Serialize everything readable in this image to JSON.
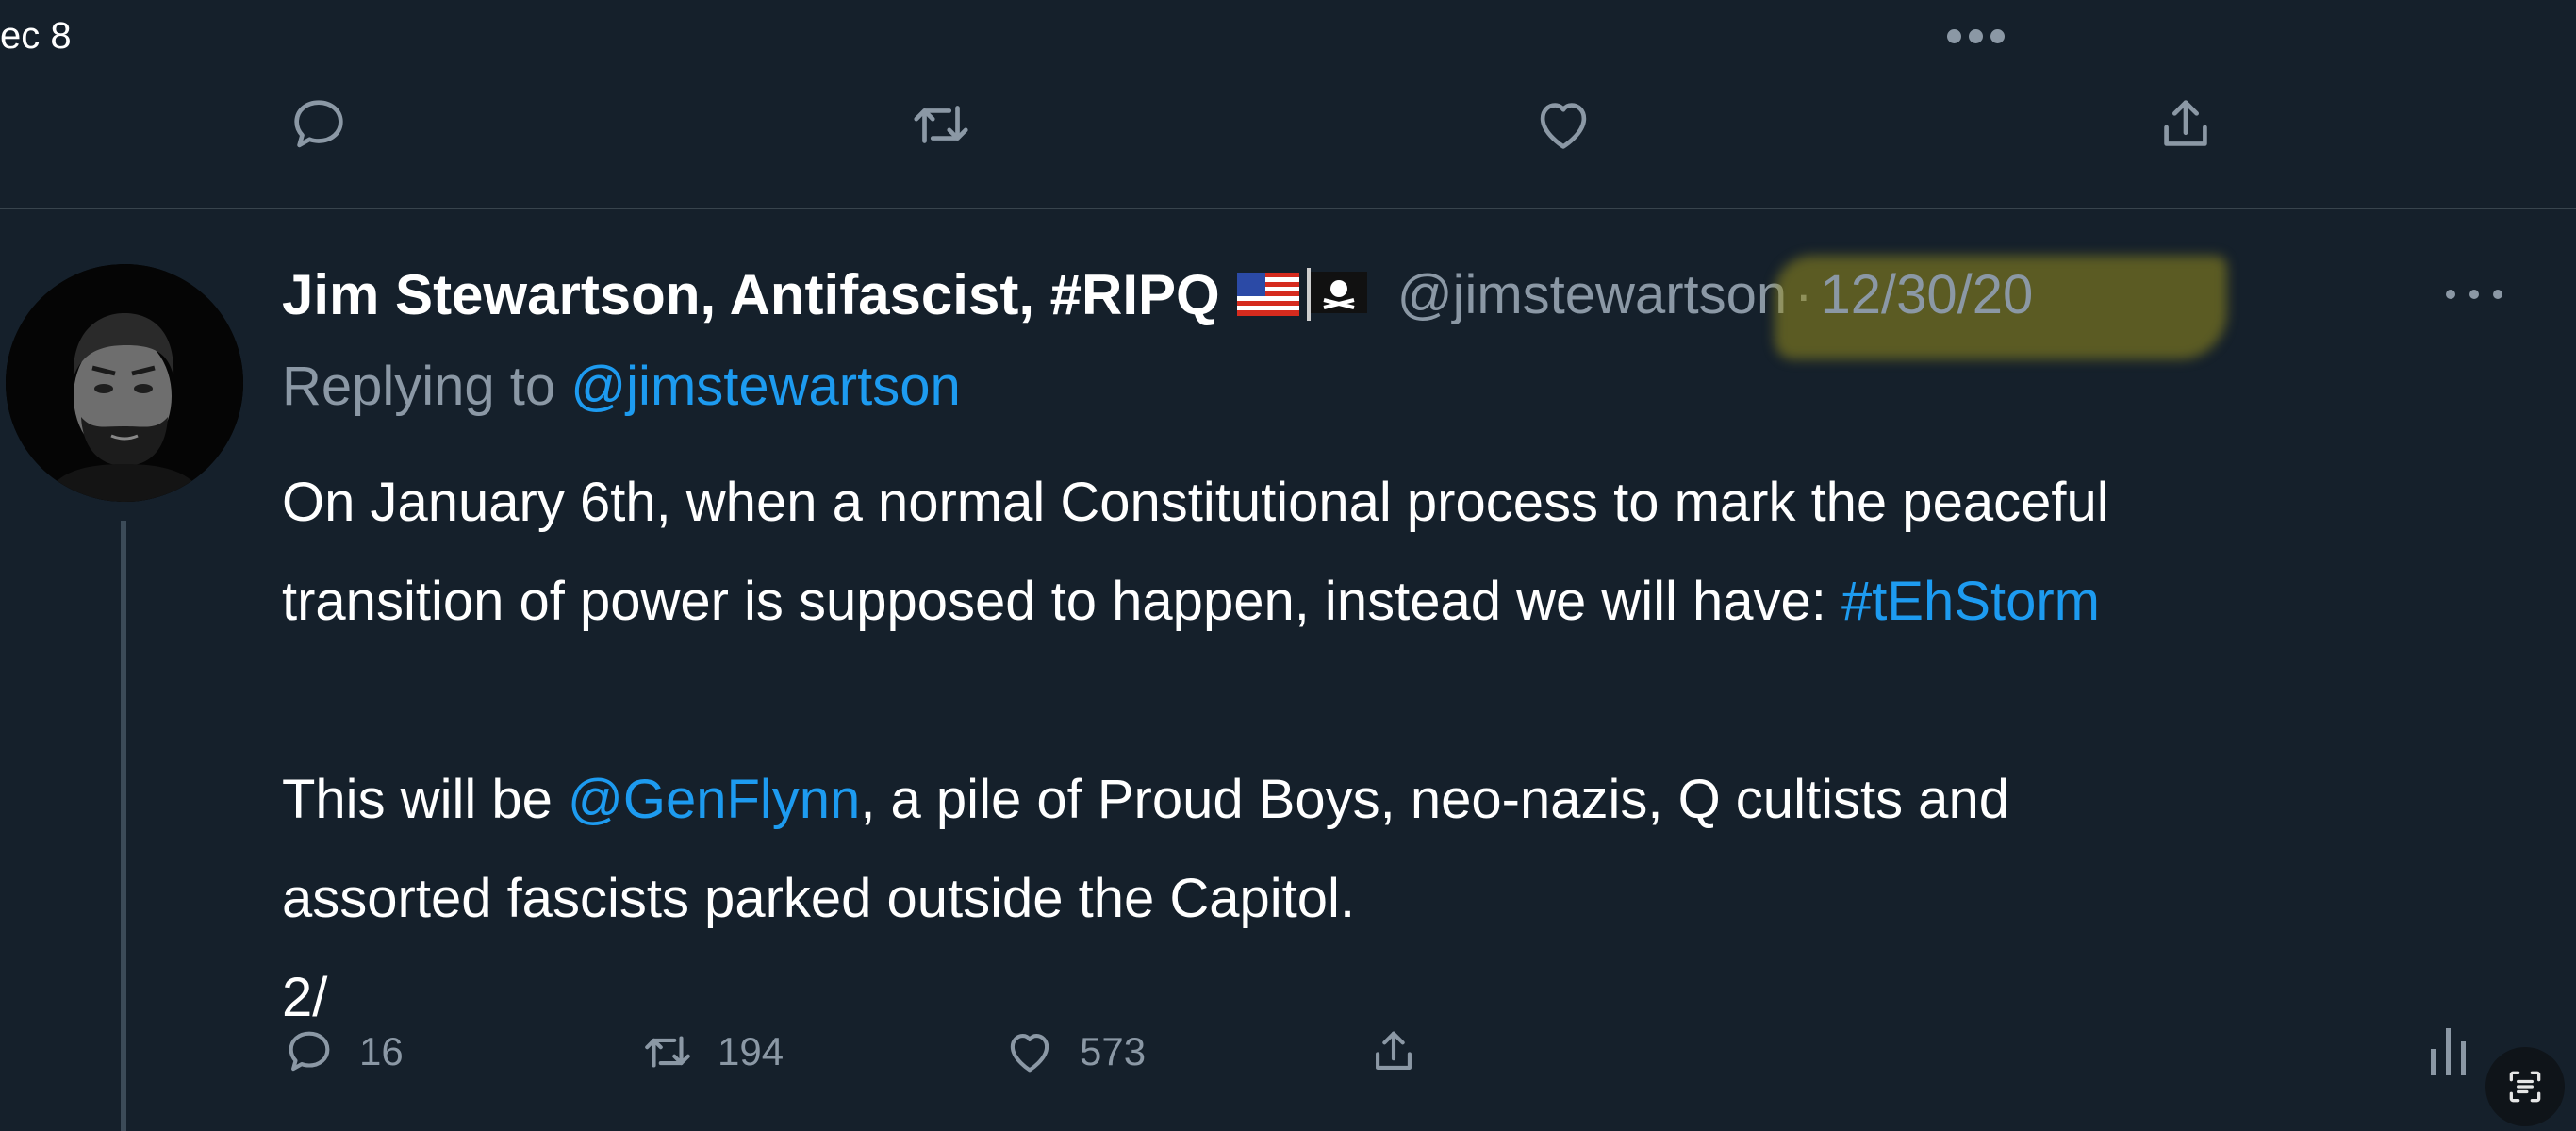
{
  "previous_tweet": {
    "date_fragment": "ec 8",
    "actions": {
      "reply_icon": "reply-icon",
      "retweet_icon": "retweet-icon",
      "like_icon": "like-icon",
      "share_icon": "share-icon"
    }
  },
  "tweet": {
    "author": {
      "display_name": "Jim Stewartson, Antifascist, #RIPQ",
      "flags": [
        "us-flag",
        "pirate-flag"
      ],
      "handle": "@jimstewartson",
      "avatar": "profile-photo-man-beard"
    },
    "separator": "·",
    "date": "12/30/20",
    "replying_prefix": "Replying to ",
    "replying_to": "@jimstewartson",
    "body": {
      "line1": "On January 6th, when a normal Constitutional process to mark the peaceful",
      "line2_text": "transition of power is supposed to happen, instead we will have: ",
      "line2_hashtag": "#tEhStorm",
      "line4_prefix": "This will be ",
      "line4_mention": "@GenFlynn",
      "line4_suffix": ", a pile of Proud Boys, neo-nazis, Q cultists and",
      "line5": "assorted fascists parked outside the Capitol.",
      "line6": "2/"
    },
    "stats": {
      "replies": "16",
      "retweets": "194",
      "likes": "573"
    }
  },
  "colors": {
    "background": "#15202b",
    "text_primary": "#ffffff",
    "text_secondary": "#8b98a5",
    "link": "#1d9bf0",
    "divider": "#38444d",
    "date_highlight": "#968c1e"
  }
}
